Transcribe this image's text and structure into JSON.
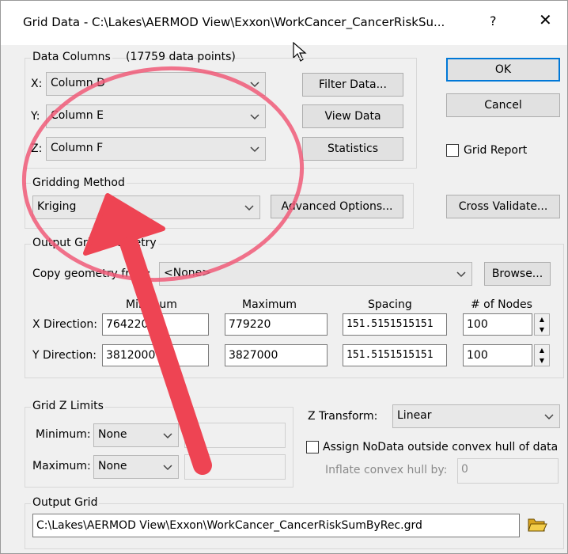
{
  "window": {
    "title": "Grid Data - C:\\Lakes\\AERMOD View\\Exxon\\WorkCancer_CancerRiskSu...",
    "help": "?",
    "close": "✕"
  },
  "data_columns": {
    "label": "Data Columns",
    "count": "(17759 data points)",
    "x_label": "X:",
    "x_value": "Column D",
    "y_label": "Y:",
    "y_value": "Column E",
    "z_label": "Z:",
    "z_value": "Column F",
    "filter_button": "Filter Data...",
    "view_button": "View Data",
    "stats_button": "Statistics"
  },
  "actions": {
    "ok": "OK",
    "cancel": "Cancel",
    "grid_report": "Grid Report",
    "cross_validate": "Cross Validate..."
  },
  "gridding": {
    "label": "Gridding Method",
    "method": "Kriging",
    "advanced_button": "Advanced Options..."
  },
  "geometry": {
    "label": "Output Grid Geometry",
    "copy_label": "Copy geometry from:",
    "copy_value": "<None>",
    "browse_button": "Browse...",
    "col_min": "Minimum",
    "col_max": "Maximum",
    "col_spacing": "Spacing",
    "col_nodes": "# of Nodes",
    "x_label": "X Direction:",
    "x_min": "764220",
    "x_max": "779220",
    "x_spacing": "151.5151515151",
    "x_nodes": "100",
    "y_label": "Y Direction:",
    "y_min": "3812000",
    "y_max": "3827000",
    "y_spacing": "151.5151515151",
    "y_nodes": "100"
  },
  "z_limits": {
    "label": "Grid Z Limits",
    "min_label": "Minimum:",
    "min_value": "None",
    "max_label": "Maximum:",
    "max_value": "None"
  },
  "z_transform": {
    "label": "Z Transform:",
    "value": "Linear",
    "assign_label": "Assign NoData outside convex hull of data",
    "inflate_label": "Inflate convex hull by:",
    "inflate_value": "0"
  },
  "output": {
    "label": "Output Grid",
    "path": "C:\\Lakes\\AERMOD View\\Exxon\\WorkCancer_CancerRiskSumByRec.grd"
  },
  "colors": {
    "annotation": "#f05a6e",
    "accent": "#0078d7"
  }
}
